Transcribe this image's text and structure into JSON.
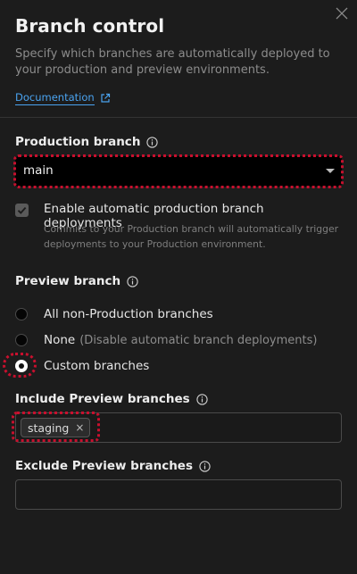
{
  "panel": {
    "title": "Branch control",
    "description": "Specify which branches are automatically deployed to your production and preview environments.",
    "documentation_link": "Documentation"
  },
  "production": {
    "label": "Production branch",
    "selected_branch": "main",
    "auto_deploy": {
      "checked": true,
      "label": "Enable automatic production branch deployments",
      "help": "Commits to your Production branch will automatically trigger deployments to your Production environment."
    }
  },
  "preview": {
    "label": "Preview branch",
    "options": [
      {
        "label": "All non-Production branches",
        "hint": "",
        "selected": false
      },
      {
        "label": "None",
        "hint": "(Disable automatic branch deployments)",
        "selected": false
      },
      {
        "label": "Custom branches",
        "hint": "",
        "selected": true
      }
    ],
    "include": {
      "label": "Include Preview branches",
      "tags": [
        "staging"
      ],
      "remove_glyph": "×"
    },
    "exclude": {
      "label": "Exclude Preview branches",
      "value": ""
    }
  },
  "colors": {
    "background": "#1c1c1c",
    "link": "#4aa3f0",
    "highlight": "#c8102e"
  }
}
